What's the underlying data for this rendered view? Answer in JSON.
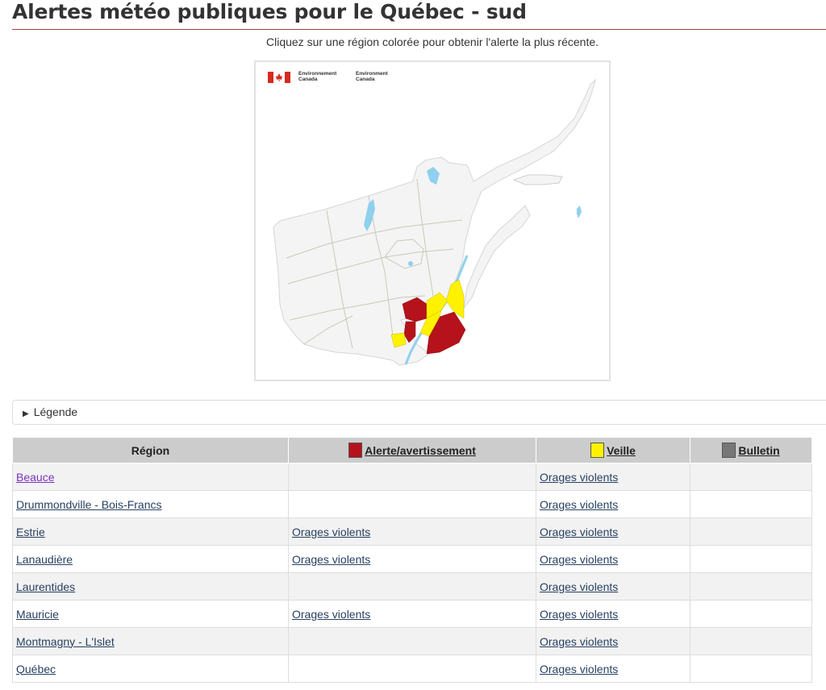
{
  "page": {
    "title": "Alertes météo publiques pour le Québec - sud",
    "instruction": "Cliquez sur une région colorée pour obtenir l'alerte la plus récente."
  },
  "map": {
    "logo_text_fr": [
      "Environnement",
      "Canada"
    ],
    "logo_text_en": [
      "Environment",
      "Canada"
    ],
    "colors": {
      "land": "#f4f4f4",
      "water": "#8fd0ee",
      "alert": "#b5121b",
      "watch": "#fff200",
      "border": "#c9c9b8"
    }
  },
  "legend": {
    "label": "Légende"
  },
  "table": {
    "headers": {
      "region": "Région",
      "alert": "Alerte/avertissement",
      "watch": "Veille",
      "bulletin": "Bulletin"
    },
    "header_colors": {
      "alert": "#b5121b",
      "watch": "#fff200",
      "bulletin": "#777777"
    },
    "rows": [
      {
        "region": "Beauce",
        "alert": "",
        "watch": "Orages violents",
        "bulletin": ""
      },
      {
        "region": "Drummondville - Bois-Francs",
        "alert": "",
        "watch": "Orages violents",
        "bulletin": ""
      },
      {
        "region": "Estrie",
        "alert": "Orages violents",
        "watch": "Orages violents",
        "bulletin": ""
      },
      {
        "region": "Lanaudière",
        "alert": "Orages violents",
        "watch": "Orages violents",
        "bulletin": ""
      },
      {
        "region": "Laurentides",
        "alert": "",
        "watch": "Orages violents",
        "bulletin": ""
      },
      {
        "region": "Mauricie",
        "alert": "Orages violents",
        "watch": "Orages violents",
        "bulletin": ""
      },
      {
        "region": "Montmagny - L'Islet",
        "alert": "",
        "watch": "Orages violents",
        "bulletin": ""
      },
      {
        "region": "Québec",
        "alert": "",
        "watch": "Orages violents",
        "bulletin": ""
      }
    ]
  }
}
